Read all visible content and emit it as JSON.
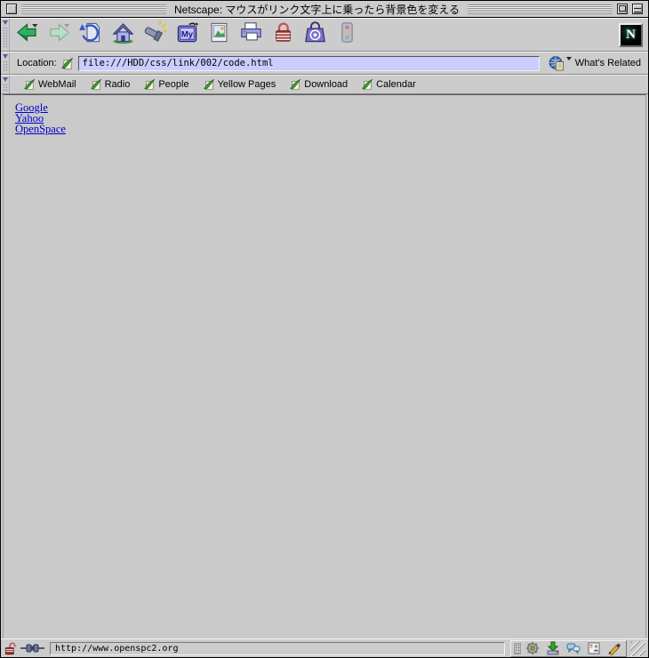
{
  "window": {
    "title": "Netscape: マウスがリンク文字上に乗ったら背景色を変える"
  },
  "colors": {
    "chrome_gray": "#cccccc",
    "content_gray": "#c9c9c9",
    "location_field_bg": "#ccccff",
    "link_blue": "#0000cc"
  },
  "toolbar": {
    "buttons": [
      "back",
      "forward",
      "reload",
      "home",
      "search",
      "my-netscape",
      "images",
      "print",
      "security",
      "shop",
      "stop"
    ],
    "my_label": "My",
    "throbber": "N"
  },
  "location_bar": {
    "label": "Location:",
    "value": "file:///HDD/css/link/002/code.html",
    "whats_related_label": "What's Related"
  },
  "personal_toolbar": {
    "items": [
      "WebMail",
      "Radio",
      "People",
      "Yellow Pages",
      "Download",
      "Calendar"
    ]
  },
  "content": {
    "links": [
      "Google",
      "Yahoo",
      "OpenSpace"
    ]
  },
  "status_bar": {
    "text": "http://www.openspc2.org"
  },
  "component_bar": {
    "icons": [
      "navigator",
      "mailbox",
      "discussions",
      "address-book",
      "composer"
    ]
  }
}
